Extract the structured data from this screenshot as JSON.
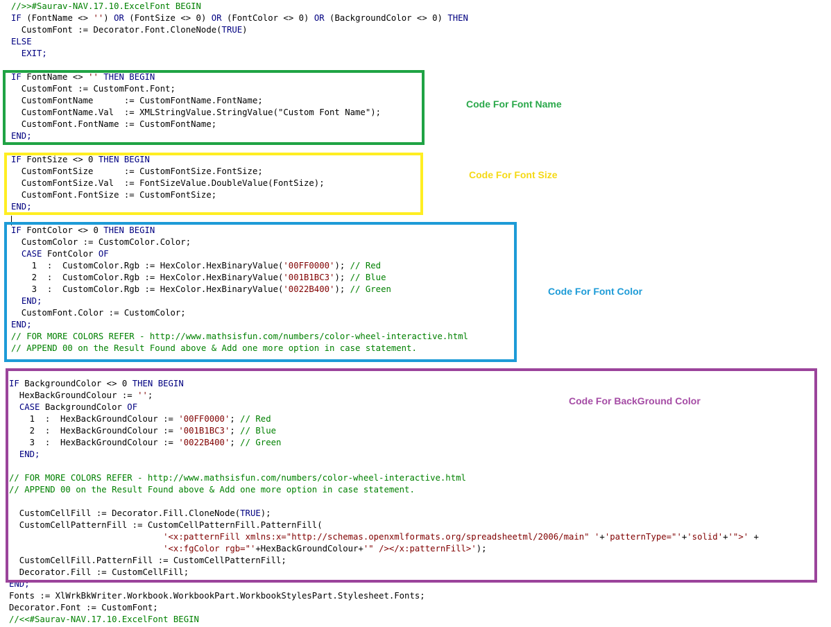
{
  "editor": {
    "lines": [
      [
        {
          "t": "//>>#Saurav-NAV.17.10.ExcelFont BEGIN",
          "c": "cmt"
        }
      ],
      [
        {
          "t": "IF",
          "c": "kw"
        },
        {
          "t": " (FontName <> "
        },
        {
          "t": "''",
          "c": "str"
        },
        {
          "t": ") "
        },
        {
          "t": "OR",
          "c": "kw"
        },
        {
          "t": " (FontSize <> 0) "
        },
        {
          "t": "OR",
          "c": "kw"
        },
        {
          "t": " (FontColor <> 0) "
        },
        {
          "t": "OR",
          "c": "kw"
        },
        {
          "t": " (BackgroundColor <> 0) "
        },
        {
          "t": "THEN",
          "c": "kw"
        }
      ],
      [
        {
          "t": "  CustomFont := Decorator.Font.CloneNode("
        },
        {
          "t": "TRUE",
          "c": "kw"
        },
        {
          "t": ")"
        }
      ],
      [
        {
          "t": "ELSE",
          "c": "kw"
        }
      ],
      [
        {
          "t": "  EXIT;",
          "c": "kw"
        }
      ],
      [],
      [
        {
          "t": "IF",
          "c": "kw"
        },
        {
          "t": " FontName <> "
        },
        {
          "t": "''",
          "c": "str"
        },
        {
          "t": " "
        },
        {
          "t": "THEN BEGIN",
          "c": "kw"
        }
      ],
      [
        {
          "t": "  CustomFont := CustomFont.Font;"
        }
      ],
      [
        {
          "t": "  CustomFontName      := CustomFontName.FontName;"
        }
      ],
      [
        {
          "t": "  CustomFontName.Val  := XMLStringValue.StringValue(\"Custom Font Name\");"
        }
      ],
      [
        {
          "t": "  CustomFont.FontName := CustomFontName;"
        }
      ],
      [
        {
          "t": "END;",
          "c": "kw"
        }
      ],
      [],
      [
        {
          "t": "IF",
          "c": "kw"
        },
        {
          "t": " FontSize <> 0 "
        },
        {
          "t": "THEN BEGIN",
          "c": "kw"
        }
      ],
      [
        {
          "t": "  CustomFontSize      := CustomFontSize.FontSize;"
        }
      ],
      [
        {
          "t": "  CustomFontSize.Val  := FontSizeValue.DoubleValue(FontSize);"
        }
      ],
      [
        {
          "t": "  CustomFont.FontSize := CustomFontSize;"
        }
      ],
      [
        {
          "t": "END;",
          "c": "kw"
        }
      ],
      [],
      [
        {
          "t": "IF",
          "c": "kw"
        },
        {
          "t": " FontColor <> 0 "
        },
        {
          "t": "THEN BEGIN",
          "c": "kw"
        }
      ],
      [
        {
          "t": "  CustomColor := CustomColor.Color;"
        }
      ],
      [
        {
          "t": "  "
        },
        {
          "t": "CASE",
          "c": "kw"
        },
        {
          "t": " FontColor "
        },
        {
          "t": "OF",
          "c": "kw"
        }
      ],
      [
        {
          "t": "    1  :  CustomColor.Rgb := HexColor.HexBinaryValue("
        },
        {
          "t": "'00FF0000'",
          "c": "str"
        },
        {
          "t": "); "
        },
        {
          "t": "// Red",
          "c": "cmt"
        }
      ],
      [
        {
          "t": "    2  :  CustomColor.Rgb := HexColor.HexBinaryValue("
        },
        {
          "t": "'001B1BC3'",
          "c": "str"
        },
        {
          "t": "); "
        },
        {
          "t": "// Blue",
          "c": "cmt"
        }
      ],
      [
        {
          "t": "    3  :  CustomColor.Rgb := HexColor.HexBinaryValue("
        },
        {
          "t": "'0022B400'",
          "c": "str"
        },
        {
          "t": "); "
        },
        {
          "t": "// Green",
          "c": "cmt"
        }
      ],
      [
        {
          "t": "  "
        },
        {
          "t": "END;",
          "c": "kw"
        }
      ],
      [
        {
          "t": "  CustomFont.Color := CustomColor;"
        }
      ],
      [
        {
          "t": "END;",
          "c": "kw"
        }
      ],
      [
        {
          "t": "// FOR MORE COLORS REFER - http://www.mathsisfun.com/numbers/color-wheel-interactive.html",
          "c": "cmt"
        }
      ],
      [
        {
          "t": "// APPEND 00 on the Result Found above & Add one more option in case statement.",
          "c": "cmt"
        }
      ],
      [],
      [],
      [
        {
          "t": "IF",
          "c": "kw"
        },
        {
          "t": " BackgroundColor <> 0 "
        },
        {
          "t": "THEN BEGIN",
          "c": "kw"
        }
      ],
      [
        {
          "t": "  HexBackGroundColour := "
        },
        {
          "t": "''",
          "c": "str"
        },
        {
          "t": ";"
        }
      ],
      [
        {
          "t": "  "
        },
        {
          "t": "CASE",
          "c": "kw"
        },
        {
          "t": " BackgroundColor "
        },
        {
          "t": "OF",
          "c": "kw"
        }
      ],
      [
        {
          "t": "    1  :  HexBackGroundColour := "
        },
        {
          "t": "'00FF0000'",
          "c": "str"
        },
        {
          "t": "; "
        },
        {
          "t": "// Red",
          "c": "cmt"
        }
      ],
      [
        {
          "t": "    2  :  HexBackGroundColour := "
        },
        {
          "t": "'001B1BC3'",
          "c": "str"
        },
        {
          "t": "; "
        },
        {
          "t": "// Blue",
          "c": "cmt"
        }
      ],
      [
        {
          "t": "    3  :  HexBackGroundColour := "
        },
        {
          "t": "'0022B400'",
          "c": "str"
        },
        {
          "t": "; "
        },
        {
          "t": "// Green",
          "c": "cmt"
        }
      ],
      [
        {
          "t": "  "
        },
        {
          "t": "END;",
          "c": "kw"
        }
      ],
      [],
      [
        {
          "t": "// FOR MORE COLORS REFER - http://www.mathsisfun.com/numbers/color-wheel-interactive.html",
          "c": "cmt"
        }
      ],
      [
        {
          "t": "// APPEND 00 on the Result Found above & Add one more option in case statement.",
          "c": "cmt"
        }
      ],
      [],
      [
        {
          "t": "  CustomCellFill := Decorator.Fill.CloneNode("
        },
        {
          "t": "TRUE",
          "c": "kw"
        },
        {
          "t": ");"
        }
      ],
      [
        {
          "t": "  CustomCellPatternFill := CustomCellPatternFill.PatternFill("
        }
      ],
      [
        {
          "t": "                              "
        },
        {
          "t": "'<x:patternFill xmlns:x=\"http://schemas.openxmlformats.org/spreadsheetml/2006/main\" '",
          "c": "str"
        },
        {
          "t": "+"
        },
        {
          "t": "'patternType=\"'",
          "c": "str"
        },
        {
          "t": "+"
        },
        {
          "t": "'solid'",
          "c": "str"
        },
        {
          "t": "+"
        },
        {
          "t": "'\">'",
          "c": "str"
        },
        {
          "t": " +"
        }
      ],
      [
        {
          "t": "                              "
        },
        {
          "t": "'<x:fgColor rgb=\"'",
          "c": "str"
        },
        {
          "t": "+HexBackGroundColour+"
        },
        {
          "t": "'\" /></x:patternFill>'",
          "c": "str"
        },
        {
          "t": ");"
        }
      ],
      [
        {
          "t": "  CustomCellFill.PatternFill := CustomCellPatternFill;"
        }
      ],
      [
        {
          "t": "  Decorator.Fill := CustomCellFill;"
        }
      ],
      [
        {
          "t": "END;",
          "c": "kw"
        }
      ],
      [
        {
          "t": "Fonts := XlWrkBkWriter.Workbook.WorkbookPart.WorkbookStylesPart.Stylesheet.Fonts;"
        }
      ],
      [
        {
          "t": "Decorator.Font := CustomFont;"
        }
      ],
      [
        {
          "t": "//<<#Saurav-NAV.17.10.ExcelFont BEGIN",
          "c": "cmt"
        }
      ]
    ]
  },
  "annotations": {
    "font_name": "Code For Font Name",
    "font_size": "Code For Font Size",
    "font_color": "Code For Font Color",
    "background_color": "Code For BackGround Color"
  },
  "colors": {
    "keyword": "#000080",
    "string": "#800000",
    "comment": "#008000",
    "font_name_box": "#1fa344",
    "font_size_box": "#ffee22",
    "font_color_box": "#1d9bd7",
    "background_color_box": "#9b449b"
  }
}
